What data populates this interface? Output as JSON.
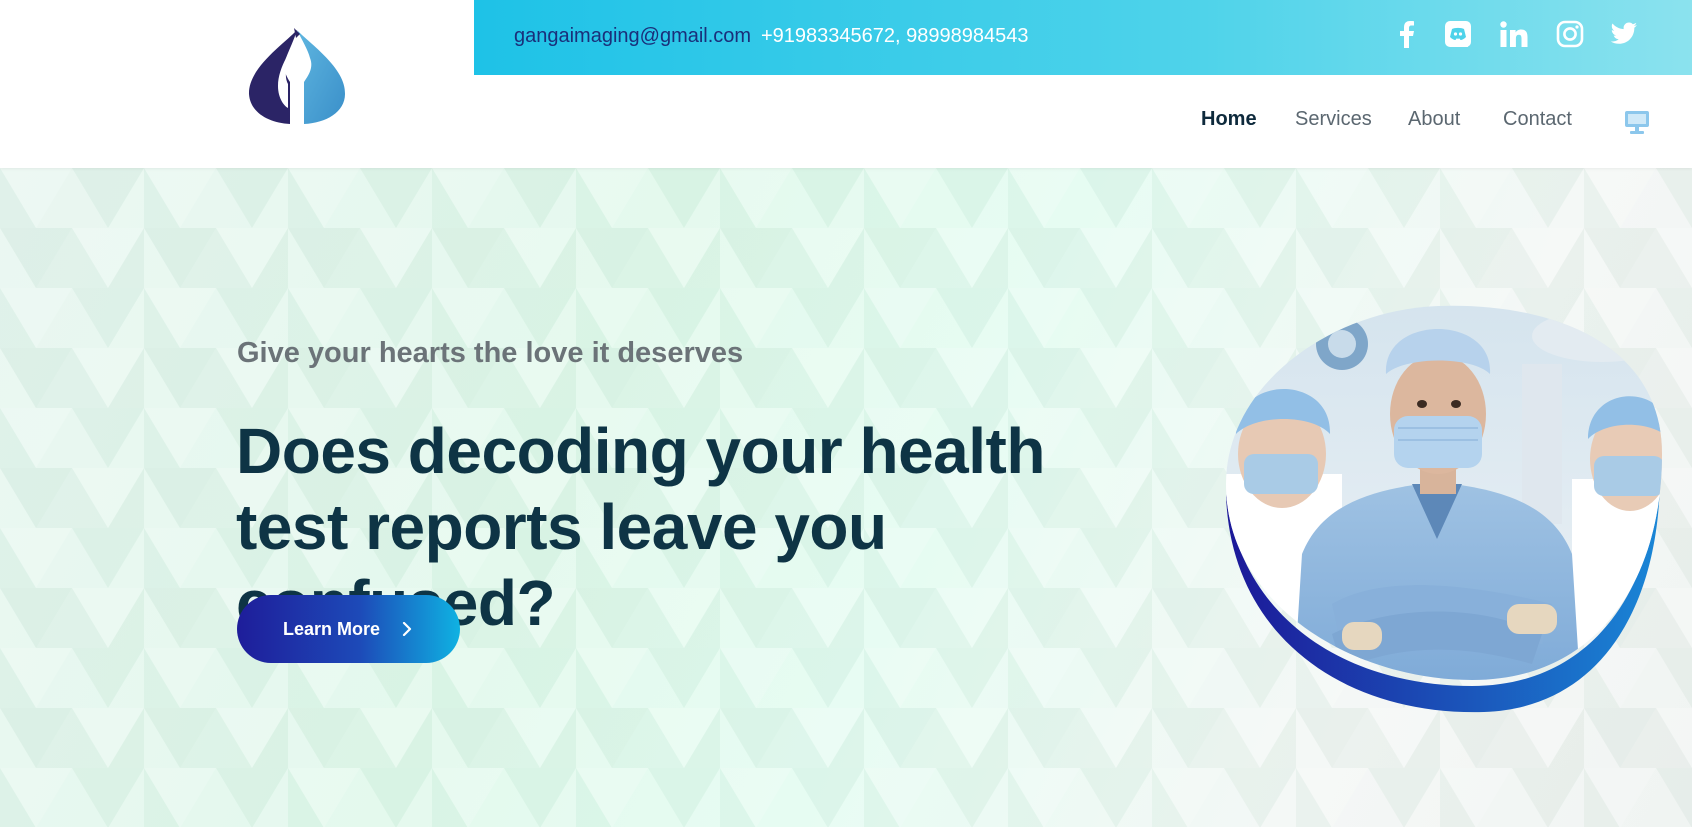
{
  "header": {
    "logo_name": "droplet-logo",
    "contact": {
      "email": "gangaimaging@gmail.com",
      "phone": "+91983345672, 98998984543"
    },
    "social_icons": [
      "facebook-icon",
      "discord-icon",
      "linkedin-icon",
      "instagram-icon",
      "twitter-icon"
    ],
    "nav": [
      {
        "label": "Home",
        "active": true
      },
      {
        "label": "Services",
        "active": false
      },
      {
        "label": "About",
        "active": false
      },
      {
        "label": "Contact",
        "active": false
      }
    ],
    "extra_icon": "monitor-icon"
  },
  "hero": {
    "tagline": "Give your hearts the love it deserves",
    "headline": "Does decoding your health test reports leave you confused?",
    "cta_label": "Learn More",
    "image": "doctors-in-surgical-masks-photo"
  },
  "colors": {
    "topbar_gradient_start": "#1ec2e7",
    "topbar_gradient_end": "#8be2ee",
    "headline": "#0e3445",
    "cta_gradient_start": "#1e1d9a",
    "cta_gradient_end": "#0fb2e2",
    "email_text": "#1a2f7a"
  }
}
